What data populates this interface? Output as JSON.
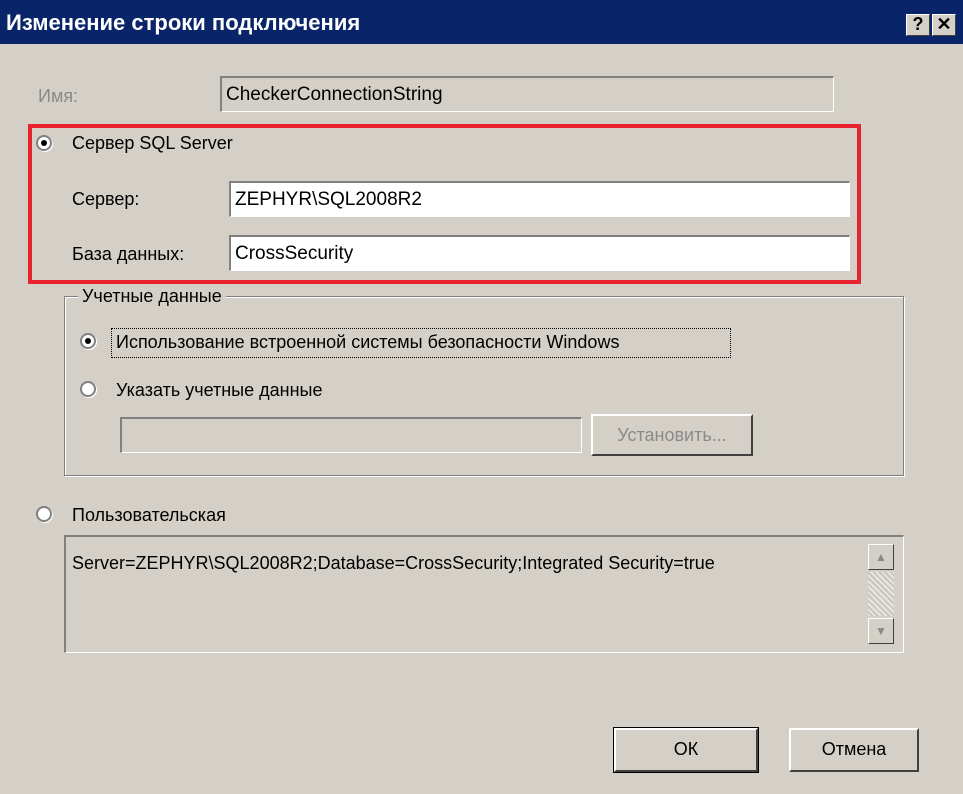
{
  "dialog": {
    "title": "Изменение строки подключения",
    "help_glyph": "?",
    "close_glyph": "✕"
  },
  "name_field": {
    "label": "Имя:",
    "value": "CheckerConnectionString"
  },
  "sql_server_option": {
    "label": "Сервер SQL Server",
    "checked": true,
    "server_label": "Сервер:",
    "server_value": "ZEPHYR\\SQL2008R2",
    "database_label": "База данных:",
    "database_value": "CrossSecurity"
  },
  "credentials": {
    "group_label": "Учетные данные",
    "windows_auth_label": "Использование встроенной системы безопасности Windows",
    "windows_auth_checked": true,
    "specify_label": "Указать учетные данные",
    "specify_checked": false,
    "set_button_label": "Установить..."
  },
  "custom_option": {
    "label": "Пользовательская",
    "checked": false,
    "connection_string": "Server=ZEPHYR\\SQL2008R2;Database=CrossSecurity;Integrated Security=true"
  },
  "buttons": {
    "ok": "ОК",
    "cancel": "Отмена"
  },
  "colors": {
    "title_bar": "#0a246a",
    "dialog_bg": "#d4d0c8",
    "highlight": "#e8222e"
  }
}
